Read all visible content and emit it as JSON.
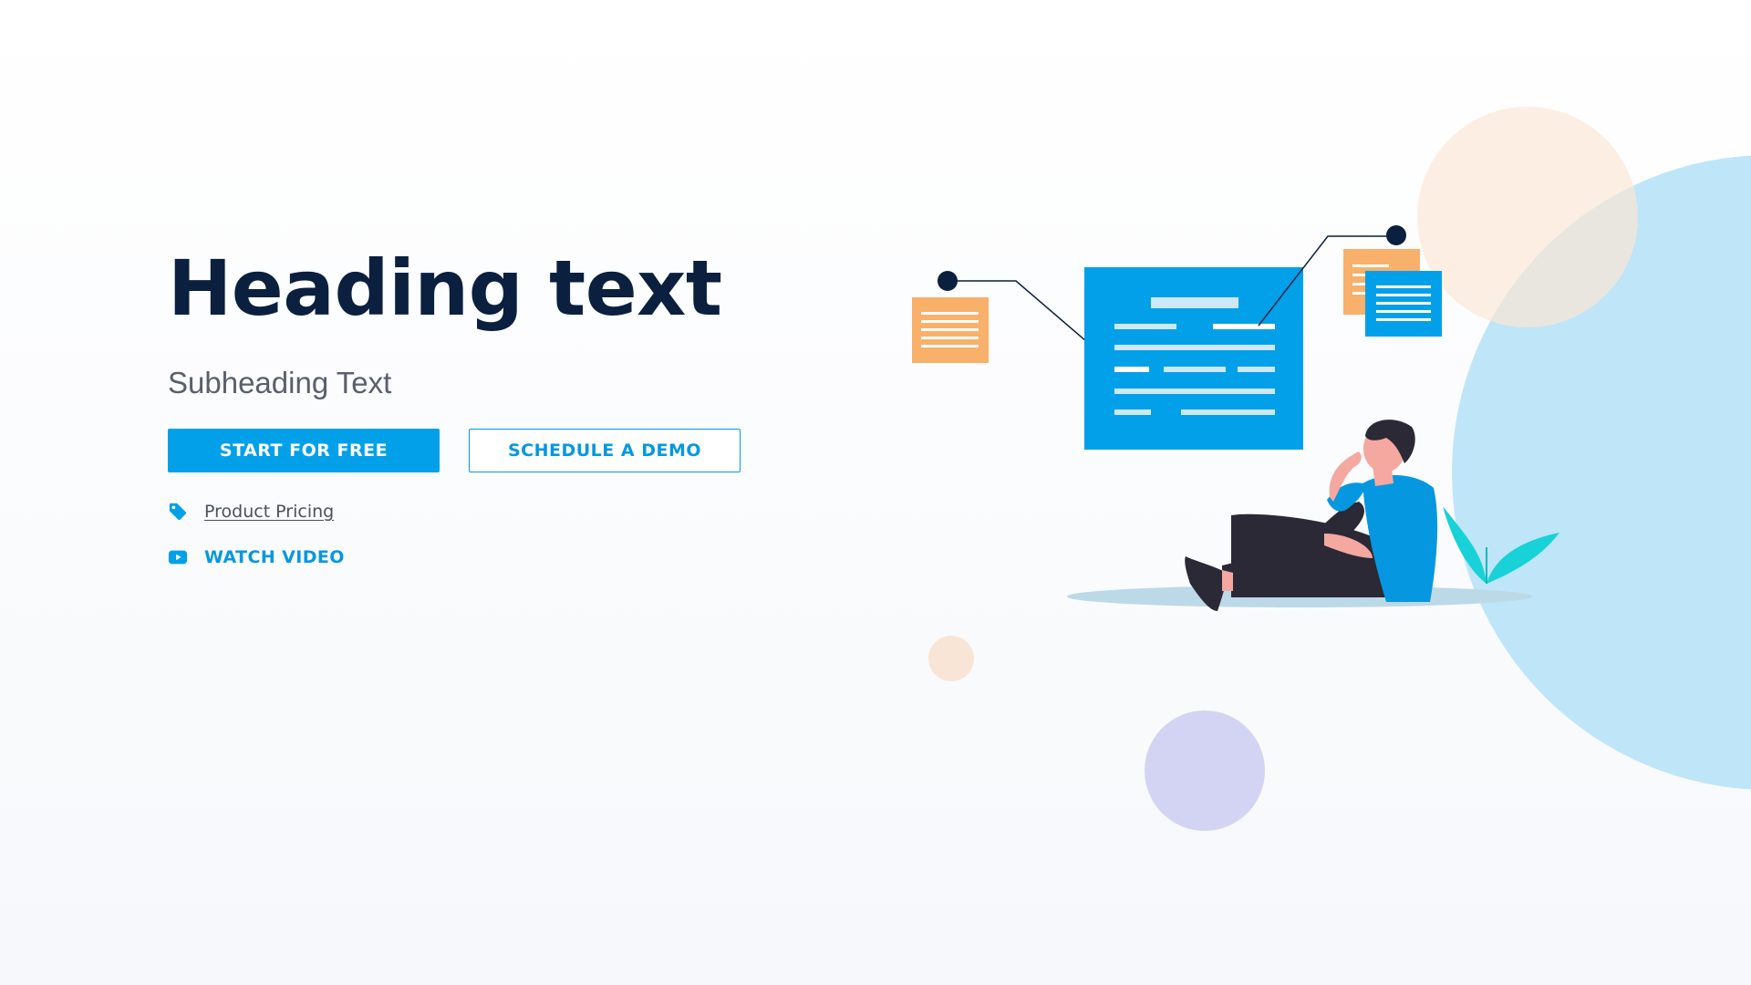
{
  "hero": {
    "heading": "Heading text",
    "subheading": "Subheading Text",
    "primary_button": "START FOR FREE",
    "secondary_button": "SCHEDULE A DEMO",
    "pricing_link": "Product Pricing",
    "video_link": "WATCH VIDEO"
  },
  "icons": {
    "pricing": "price-tag-icon",
    "video": "youtube-play-icon"
  },
  "colors": {
    "brand_blue": "#03a0ea",
    "heading_navy": "#0b1f3f",
    "accent_orange": "#f8b06a",
    "accent_teal": "#18d2d8",
    "light_blue_blob": "#bde4f7",
    "peach_blob": "#fdeee2",
    "lavender_blob": "#d2d4f2"
  }
}
